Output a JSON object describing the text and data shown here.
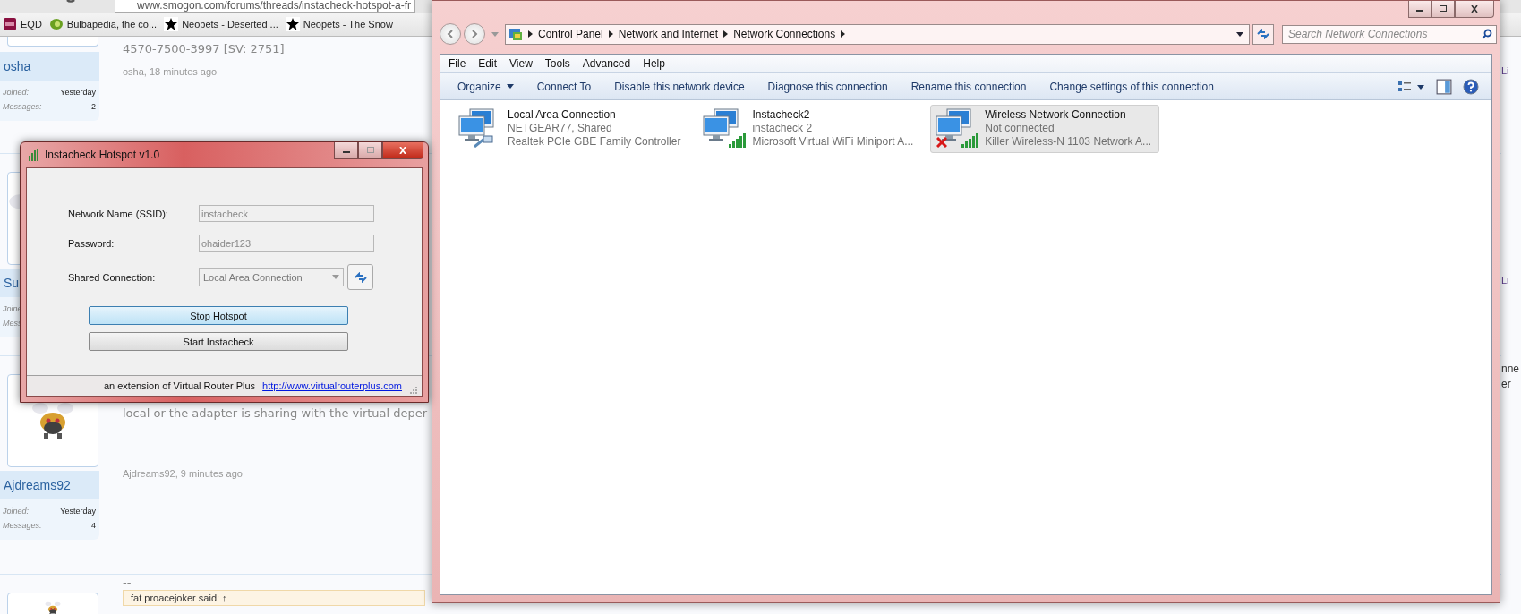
{
  "browser": {
    "address": "www.smogon.com/forums/threads/instacheck-hotspot-a-fr",
    "bookmarks": [
      {
        "label": "EQD",
        "kind": "square"
      },
      {
        "label": "Bulbapedia, the co...",
        "kind": "leaf"
      },
      {
        "label": "Neopets - Deserted ...",
        "kind": "star"
      },
      {
        "label": "Neopets - The Snow",
        "kind": "star"
      }
    ]
  },
  "posts": [
    {
      "kind": "cut",
      "user": "osha",
      "joined_label": "Joined:",
      "joined": "Yesterday",
      "messages_label": "Messages:",
      "messages": "2",
      "body": "4570-7500-3997 [SV: 2751]",
      "meta": "osha, 18 minutes ago"
    },
    {
      "kind": "picture",
      "user": "Su",
      "joined_label": "Joine",
      "messages_label": "Mess"
    },
    {
      "kind": "picture",
      "user": "Ajdreams92",
      "joined_label": "Joined:",
      "joined": "Yesterday",
      "messages_label": "Messages:",
      "messages": "4",
      "body": "local or the adapter is sharing with the virtual deper",
      "meta": "Ajdreams92, 9 minutes ago"
    },
    {
      "kind": "picture",
      "body": "--",
      "quote": "fat proacejoker said: ↑"
    }
  ],
  "right_edge": [
    "Li",
    "Li",
    "nne",
    "er"
  ],
  "explorer": {
    "breadcrumb": [
      "Control Panel",
      "Network and Internet",
      "Network Connections"
    ],
    "search": {
      "placeholder": "Search Network Connections"
    },
    "menu": [
      "File",
      "Edit",
      "View",
      "Tools",
      "Advanced",
      "Help"
    ],
    "commands": [
      {
        "label": "Organize",
        "dropdown": true
      },
      {
        "label": "Connect To",
        "dropdown": false
      },
      {
        "label": "Disable this network device",
        "dropdown": false
      },
      {
        "label": "Diagnose this connection",
        "dropdown": false
      },
      {
        "label": "Rename this connection",
        "dropdown": false
      },
      {
        "label": "Change settings of this connection",
        "dropdown": false
      }
    ],
    "connections": [
      {
        "name": "Local Area Connection",
        "status": "NETGEAR77, Shared",
        "adapter": "Realtek PCIe GBE Family Controller",
        "kind": "wired",
        "connected": true,
        "selected": false
      },
      {
        "name": "Instacheck2",
        "status": "instacheck  2",
        "adapter": "Microsoft Virtual WiFi Miniport A...",
        "kind": "wireless",
        "connected": true,
        "selected": false
      },
      {
        "name": "Wireless Network Connection",
        "status": "Not connected",
        "adapter": "Killer Wireless-N 1103 Network A...",
        "kind": "wireless",
        "connected": false,
        "selected": true
      }
    ]
  },
  "hotspot": {
    "title": "Instacheck Hotspot v1.0",
    "fields": [
      {
        "label": "Network Name (SSID):",
        "value": "instacheck",
        "kind": "text",
        "disabled": true
      },
      {
        "label": "Password:",
        "value": "ohaider123",
        "kind": "text",
        "disabled": true
      },
      {
        "label": "Shared Connection:",
        "value": "Local Area Connection",
        "kind": "select",
        "disabled": true
      }
    ],
    "buttons": [
      {
        "label": "Stop Hotspot",
        "default": true
      },
      {
        "label": "Start Instacheck",
        "default": false
      }
    ],
    "footer": "an extension of Virtual Router Plus",
    "link": "http://www.virtualrouterplus.com"
  }
}
